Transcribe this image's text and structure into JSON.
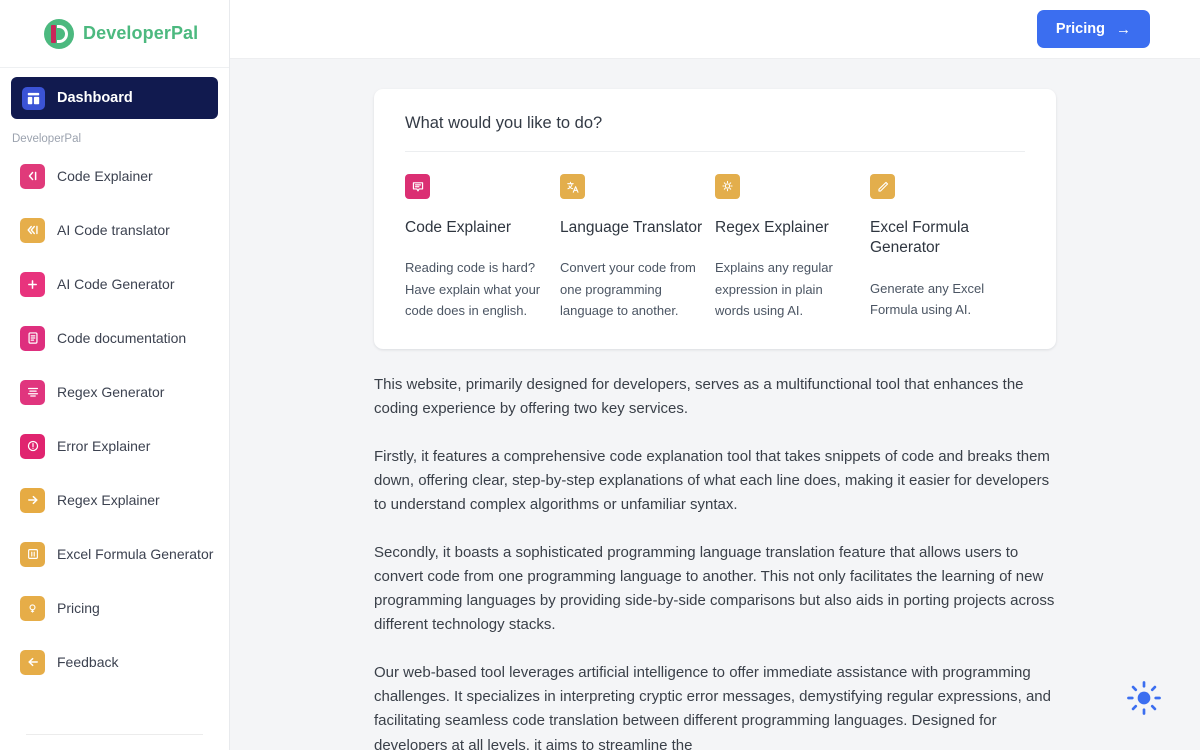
{
  "brand": {
    "name": "DeveloperPal",
    "logo_icon": "developerpal-logo-icon",
    "accent_green": "#4cb97f",
    "accent_pink": "#c9275a"
  },
  "sidebar": {
    "dashboard": {
      "label": "Dashboard",
      "icon": "dashboard-grid-icon",
      "active": true,
      "bg": "#111a4f"
    },
    "section_label": "DeveloperPal",
    "items": [
      {
        "label": "Code Explainer",
        "icon": "chevron-left-code-icon",
        "color": "#e03a7a"
      },
      {
        "label": "AI Code translator",
        "icon": "double-chevron-left-icon",
        "color": "#e6ae4a"
      },
      {
        "label": "AI Code Generator",
        "icon": "plus-icon",
        "color": "#e8337d"
      },
      {
        "label": "Code documentation",
        "icon": "document-icon",
        "color": "#de2f7e"
      },
      {
        "label": "Regex Generator",
        "icon": "align-lines-icon",
        "color": "#e0357e"
      },
      {
        "label": "Error Explainer",
        "icon": "error-circle-icon",
        "color": "#e0246f"
      },
      {
        "label": "Regex Explainer",
        "icon": "arrow-right-icon",
        "color": "#e6ab43"
      },
      {
        "label": "Excel Formula Generator",
        "icon": "spreadsheet-icon",
        "color": "#e4ab46"
      },
      {
        "label": "Pricing",
        "icon": "lightbulb-icon",
        "color": "#e6ad48"
      },
      {
        "label": "Feedback",
        "icon": "arrow-left-icon",
        "color": "#e6ad48"
      }
    ]
  },
  "topbar": {
    "pricing_button": {
      "label": "Pricing",
      "arrow": "→",
      "color": "#3b6ef0"
    }
  },
  "card": {
    "title": "What would you like to do?",
    "tools": [
      {
        "name": "Code Explainer",
        "icon": "chat-bubble-icon",
        "color": "#db2f73",
        "description": "Reading code is hard? Have explain what your code does in english."
      },
      {
        "name": "Language Translator",
        "icon": "translate-icon",
        "color": "#e3ae4c",
        "description": "Convert your code from one programming language to another."
      },
      {
        "name": "Regex Explainer",
        "icon": "lightbulb-icon",
        "color": "#e3ae4c",
        "description": "Explains any regular expression in plain words using AI."
      },
      {
        "name": "Excel Formula Generator",
        "icon": "pencil-icon",
        "color": "#e3ae4c",
        "description": "Generate any Excel Formula using AI."
      }
    ]
  },
  "prose": {
    "p1": "This website, primarily designed for developers, serves as a multifunctional tool that enhances the coding experience by offering two key services.",
    "p2": "Firstly, it features a comprehensive code explanation tool that takes snippets of code and breaks them down, offering clear, step-by-step explanations of what each line does, making it easier for developers to understand complex algorithms or unfamiliar syntax.",
    "p3": "Secondly, it boasts a sophisticated programming language translation feature that allows users to convert code from one programming language to another. This not only facilitates the learning of new programming languages by providing side-by-side comparisons but also aids in porting projects across different technology stacks.",
    "p4": "Our web-based tool leverages artificial intelligence to offer immediate assistance with programming challenges. It specializes in interpreting cryptic error messages, demystifying regular expressions, and facilitating seamless code translation between different programming languages. Designed for developers at all levels, it aims to streamline the"
  },
  "theme_toggle": {
    "icon": "sun-icon",
    "color": "#3b6ef0"
  }
}
